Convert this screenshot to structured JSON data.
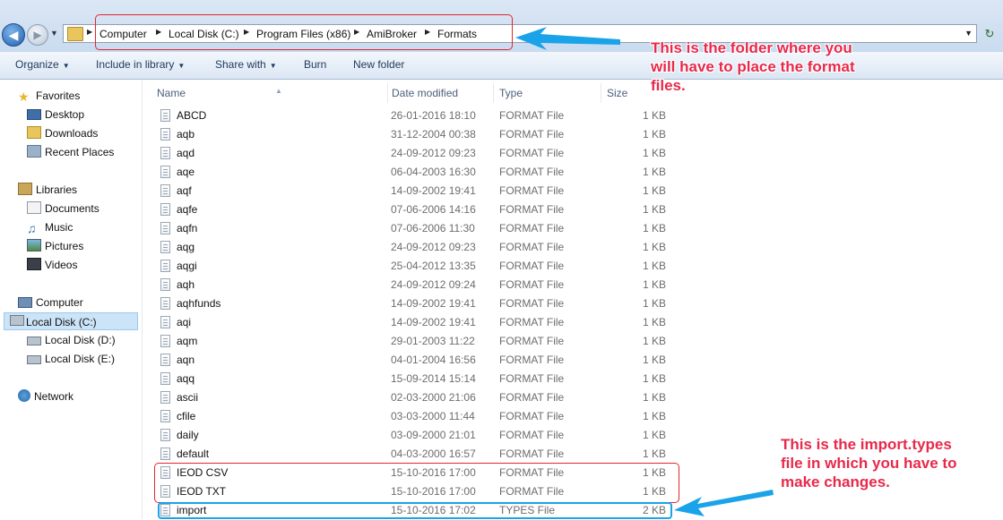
{
  "address": {
    "crumbs": [
      "Computer",
      "Local Disk (C:)",
      "Program Files (x86)",
      "AmiBroker",
      "Formats"
    ]
  },
  "toolbar": {
    "organize": "Organize",
    "include_in_library": "Include in library",
    "share_with": "Share with",
    "burn": "Burn",
    "new_folder": "New folder"
  },
  "nav": {
    "favorites": "Favorites",
    "desktop": "Desktop",
    "downloads": "Downloads",
    "recent_places": "Recent Places",
    "libraries": "Libraries",
    "documents": "Documents",
    "music": "Music",
    "pictures": "Pictures",
    "videos": "Videos",
    "computer": "Computer",
    "local_c": "Local Disk (C:)",
    "local_d": "Local Disk (D:)",
    "local_e": "Local Disk (E:)",
    "network": "Network"
  },
  "columns": {
    "name": "Name",
    "date": "Date modified",
    "type": "Type",
    "size": "Size"
  },
  "files": [
    {
      "name": "ABCD",
      "date": "26-01-2016 18:10",
      "type": "FORMAT File",
      "size": "1 KB"
    },
    {
      "name": "aqb",
      "date": "31-12-2004 00:38",
      "type": "FORMAT File",
      "size": "1 KB"
    },
    {
      "name": "aqd",
      "date": "24-09-2012 09:23",
      "type": "FORMAT File",
      "size": "1 KB"
    },
    {
      "name": "aqe",
      "date": "06-04-2003 16:30",
      "type": "FORMAT File",
      "size": "1 KB"
    },
    {
      "name": "aqf",
      "date": "14-09-2002 19:41",
      "type": "FORMAT File",
      "size": "1 KB"
    },
    {
      "name": "aqfe",
      "date": "07-06-2006 14:16",
      "type": "FORMAT File",
      "size": "1 KB"
    },
    {
      "name": "aqfn",
      "date": "07-06-2006 11:30",
      "type": "FORMAT File",
      "size": "1 KB"
    },
    {
      "name": "aqg",
      "date": "24-09-2012 09:23",
      "type": "FORMAT File",
      "size": "1 KB"
    },
    {
      "name": "aqgi",
      "date": "25-04-2012 13:35",
      "type": "FORMAT File",
      "size": "1 KB"
    },
    {
      "name": "aqh",
      "date": "24-09-2012 09:24",
      "type": "FORMAT File",
      "size": "1 KB"
    },
    {
      "name": "aqhfunds",
      "date": "14-09-2002 19:41",
      "type": "FORMAT File",
      "size": "1 KB"
    },
    {
      "name": "aqi",
      "date": "14-09-2002 19:41",
      "type": "FORMAT File",
      "size": "1 KB"
    },
    {
      "name": "aqm",
      "date": "29-01-2003 11:22",
      "type": "FORMAT File",
      "size": "1 KB"
    },
    {
      "name": "aqn",
      "date": "04-01-2004 16:56",
      "type": "FORMAT File",
      "size": "1 KB"
    },
    {
      "name": "aqq",
      "date": "15-09-2014 15:14",
      "type": "FORMAT File",
      "size": "1 KB"
    },
    {
      "name": "ascii",
      "date": "02-03-2000 21:06",
      "type": "FORMAT File",
      "size": "1 KB"
    },
    {
      "name": "cfile",
      "date": "03-03-2000 11:44",
      "type": "FORMAT File",
      "size": "1 KB"
    },
    {
      "name": "daily",
      "date": "03-09-2000 21:01",
      "type": "FORMAT File",
      "size": "1 KB"
    },
    {
      "name": "default",
      "date": "04-03-2000 16:57",
      "type": "FORMAT File",
      "size": "1 KB"
    },
    {
      "name": "IEOD CSV",
      "date": "15-10-2016 17:00",
      "type": "FORMAT File",
      "size": "1 KB"
    },
    {
      "name": "IEOD TXT",
      "date": "15-10-2016 17:00",
      "type": "FORMAT File",
      "size": "1 KB"
    },
    {
      "name": "import",
      "date": "15-10-2016 17:02",
      "type": "TYPES File",
      "size": "2 KB"
    }
  ],
  "annotations": {
    "folder_note": [
      "This is the folder where you",
      "will have to place the format",
      "files."
    ],
    "import_note": [
      "This is the import.types",
      "file in which you have to",
      "make changes."
    ]
  },
  "colors": {
    "note_text": "#e8294a",
    "red_box": "#e2262e",
    "blue_box": "#1aa3e8"
  }
}
